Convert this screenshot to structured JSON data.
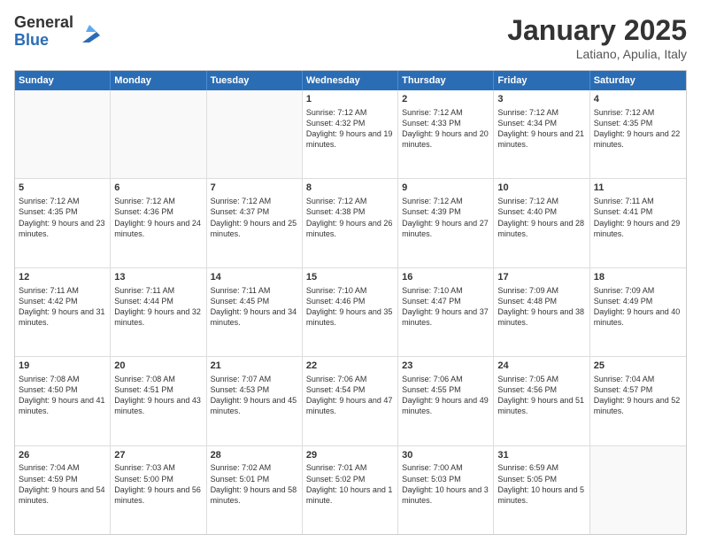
{
  "logo": {
    "general": "General",
    "blue": "Blue"
  },
  "title": "January 2025",
  "location": "Latiano, Apulia, Italy",
  "header_days": [
    "Sunday",
    "Monday",
    "Tuesday",
    "Wednesday",
    "Thursday",
    "Friday",
    "Saturday"
  ],
  "weeks": [
    [
      {
        "day": "",
        "empty": true
      },
      {
        "day": "",
        "empty": true
      },
      {
        "day": "",
        "empty": true
      },
      {
        "day": "1",
        "sunrise": "Sunrise: 7:12 AM",
        "sunset": "Sunset: 4:32 PM",
        "daylight": "Daylight: 9 hours and 19 minutes."
      },
      {
        "day": "2",
        "sunrise": "Sunrise: 7:12 AM",
        "sunset": "Sunset: 4:33 PM",
        "daylight": "Daylight: 9 hours and 20 minutes."
      },
      {
        "day": "3",
        "sunrise": "Sunrise: 7:12 AM",
        "sunset": "Sunset: 4:34 PM",
        "daylight": "Daylight: 9 hours and 21 minutes."
      },
      {
        "day": "4",
        "sunrise": "Sunrise: 7:12 AM",
        "sunset": "Sunset: 4:35 PM",
        "daylight": "Daylight: 9 hours and 22 minutes."
      }
    ],
    [
      {
        "day": "5",
        "sunrise": "Sunrise: 7:12 AM",
        "sunset": "Sunset: 4:35 PM",
        "daylight": "Daylight: 9 hours and 23 minutes."
      },
      {
        "day": "6",
        "sunrise": "Sunrise: 7:12 AM",
        "sunset": "Sunset: 4:36 PM",
        "daylight": "Daylight: 9 hours and 24 minutes."
      },
      {
        "day": "7",
        "sunrise": "Sunrise: 7:12 AM",
        "sunset": "Sunset: 4:37 PM",
        "daylight": "Daylight: 9 hours and 25 minutes."
      },
      {
        "day": "8",
        "sunrise": "Sunrise: 7:12 AM",
        "sunset": "Sunset: 4:38 PM",
        "daylight": "Daylight: 9 hours and 26 minutes."
      },
      {
        "day": "9",
        "sunrise": "Sunrise: 7:12 AM",
        "sunset": "Sunset: 4:39 PM",
        "daylight": "Daylight: 9 hours and 27 minutes."
      },
      {
        "day": "10",
        "sunrise": "Sunrise: 7:12 AM",
        "sunset": "Sunset: 4:40 PM",
        "daylight": "Daylight: 9 hours and 28 minutes."
      },
      {
        "day": "11",
        "sunrise": "Sunrise: 7:11 AM",
        "sunset": "Sunset: 4:41 PM",
        "daylight": "Daylight: 9 hours and 29 minutes."
      }
    ],
    [
      {
        "day": "12",
        "sunrise": "Sunrise: 7:11 AM",
        "sunset": "Sunset: 4:42 PM",
        "daylight": "Daylight: 9 hours and 31 minutes."
      },
      {
        "day": "13",
        "sunrise": "Sunrise: 7:11 AM",
        "sunset": "Sunset: 4:44 PM",
        "daylight": "Daylight: 9 hours and 32 minutes."
      },
      {
        "day": "14",
        "sunrise": "Sunrise: 7:11 AM",
        "sunset": "Sunset: 4:45 PM",
        "daylight": "Daylight: 9 hours and 34 minutes."
      },
      {
        "day": "15",
        "sunrise": "Sunrise: 7:10 AM",
        "sunset": "Sunset: 4:46 PM",
        "daylight": "Daylight: 9 hours and 35 minutes."
      },
      {
        "day": "16",
        "sunrise": "Sunrise: 7:10 AM",
        "sunset": "Sunset: 4:47 PM",
        "daylight": "Daylight: 9 hours and 37 minutes."
      },
      {
        "day": "17",
        "sunrise": "Sunrise: 7:09 AM",
        "sunset": "Sunset: 4:48 PM",
        "daylight": "Daylight: 9 hours and 38 minutes."
      },
      {
        "day": "18",
        "sunrise": "Sunrise: 7:09 AM",
        "sunset": "Sunset: 4:49 PM",
        "daylight": "Daylight: 9 hours and 40 minutes."
      }
    ],
    [
      {
        "day": "19",
        "sunrise": "Sunrise: 7:08 AM",
        "sunset": "Sunset: 4:50 PM",
        "daylight": "Daylight: 9 hours and 41 minutes."
      },
      {
        "day": "20",
        "sunrise": "Sunrise: 7:08 AM",
        "sunset": "Sunset: 4:51 PM",
        "daylight": "Daylight: 9 hours and 43 minutes."
      },
      {
        "day": "21",
        "sunrise": "Sunrise: 7:07 AM",
        "sunset": "Sunset: 4:53 PM",
        "daylight": "Daylight: 9 hours and 45 minutes."
      },
      {
        "day": "22",
        "sunrise": "Sunrise: 7:06 AM",
        "sunset": "Sunset: 4:54 PM",
        "daylight": "Daylight: 9 hours and 47 minutes."
      },
      {
        "day": "23",
        "sunrise": "Sunrise: 7:06 AM",
        "sunset": "Sunset: 4:55 PM",
        "daylight": "Daylight: 9 hours and 49 minutes."
      },
      {
        "day": "24",
        "sunrise": "Sunrise: 7:05 AM",
        "sunset": "Sunset: 4:56 PM",
        "daylight": "Daylight: 9 hours and 51 minutes."
      },
      {
        "day": "25",
        "sunrise": "Sunrise: 7:04 AM",
        "sunset": "Sunset: 4:57 PM",
        "daylight": "Daylight: 9 hours and 52 minutes."
      }
    ],
    [
      {
        "day": "26",
        "sunrise": "Sunrise: 7:04 AM",
        "sunset": "Sunset: 4:59 PM",
        "daylight": "Daylight: 9 hours and 54 minutes."
      },
      {
        "day": "27",
        "sunrise": "Sunrise: 7:03 AM",
        "sunset": "Sunset: 5:00 PM",
        "daylight": "Daylight: 9 hours and 56 minutes."
      },
      {
        "day": "28",
        "sunrise": "Sunrise: 7:02 AM",
        "sunset": "Sunset: 5:01 PM",
        "daylight": "Daylight: 9 hours and 58 minutes."
      },
      {
        "day": "29",
        "sunrise": "Sunrise: 7:01 AM",
        "sunset": "Sunset: 5:02 PM",
        "daylight": "Daylight: 10 hours and 1 minute."
      },
      {
        "day": "30",
        "sunrise": "Sunrise: 7:00 AM",
        "sunset": "Sunset: 5:03 PM",
        "daylight": "Daylight: 10 hours and 3 minutes."
      },
      {
        "day": "31",
        "sunrise": "Sunrise: 6:59 AM",
        "sunset": "Sunset: 5:05 PM",
        "daylight": "Daylight: 10 hours and 5 minutes."
      },
      {
        "day": "",
        "empty": true
      }
    ]
  ]
}
